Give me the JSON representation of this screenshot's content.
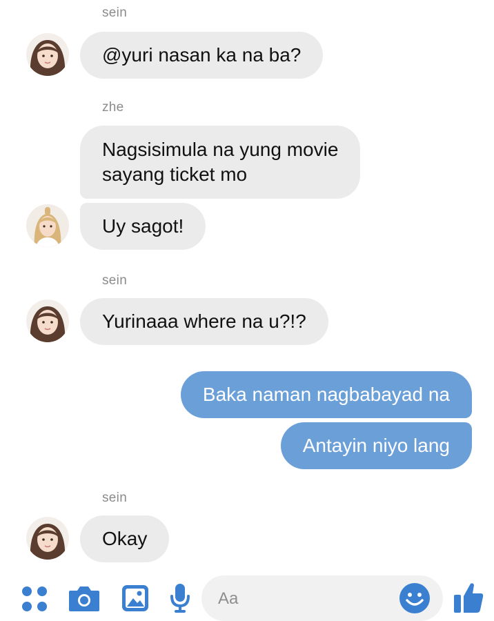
{
  "messages": [
    {
      "sender": "sein",
      "text": "@yuri nasan ka na ba?"
    },
    {
      "sender": "zhe",
      "lines": [
        "Nagsisimula na yung movie",
        "sayang ticket mo"
      ]
    },
    {
      "text": "Uy sagot!"
    },
    {
      "sender": "sein",
      "text": "Yurinaaa where na u?!?"
    },
    {
      "text": "Baka naman nagbabayad na"
    },
    {
      "text": "Antayin niyo lang"
    },
    {
      "sender": "sein",
      "text": "Okay"
    }
  ],
  "composer": {
    "placeholder": "Aa",
    "icons": [
      "apps-icon",
      "camera-icon",
      "image-icon",
      "microphone-icon",
      "emoji-icon",
      "thumbs-up-icon"
    ]
  },
  "colors": {
    "incoming_bubble": "#ebebeb",
    "outgoing_bubble": "#6b9fd8",
    "accent": "#3a7fd0",
    "sender_name": "#8b8b8b"
  }
}
